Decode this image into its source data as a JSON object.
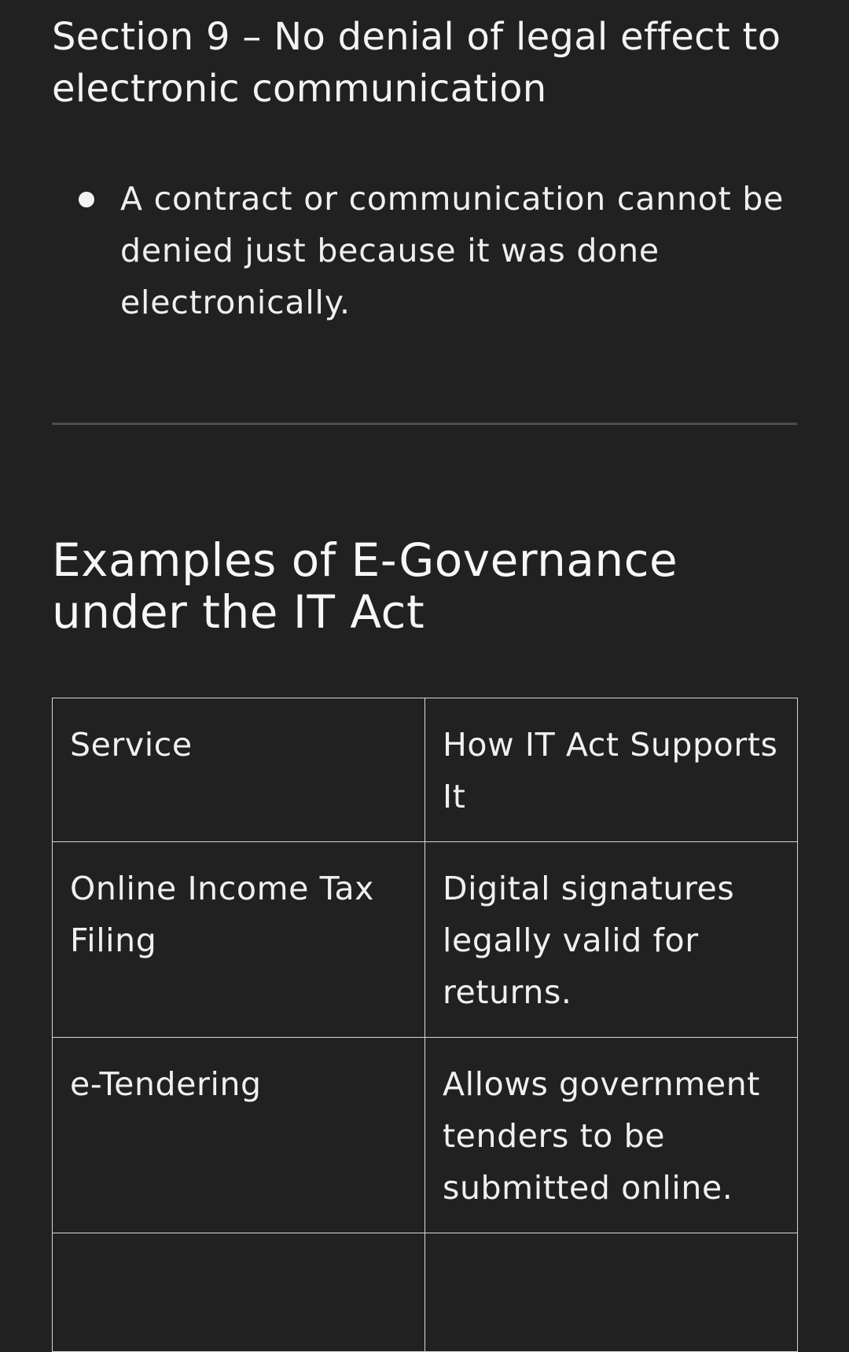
{
  "section_title": "Section 9 – No denial of legal effect to electronic communication",
  "bullets": [
    "A contract or communication cannot be denied just because it was done electronically."
  ],
  "examples_heading": "Examples of E-Governance under the IT Act",
  "table": {
    "headers": [
      "Service",
      "How IT Act Supports It"
    ],
    "rows": [
      [
        "Online Income Tax Filing",
        "Digital signatures legally valid for returns."
      ],
      [
        "e-Tendering",
        "Allows government tenders to be submitted online."
      ],
      [
        "",
        ""
      ]
    ]
  }
}
